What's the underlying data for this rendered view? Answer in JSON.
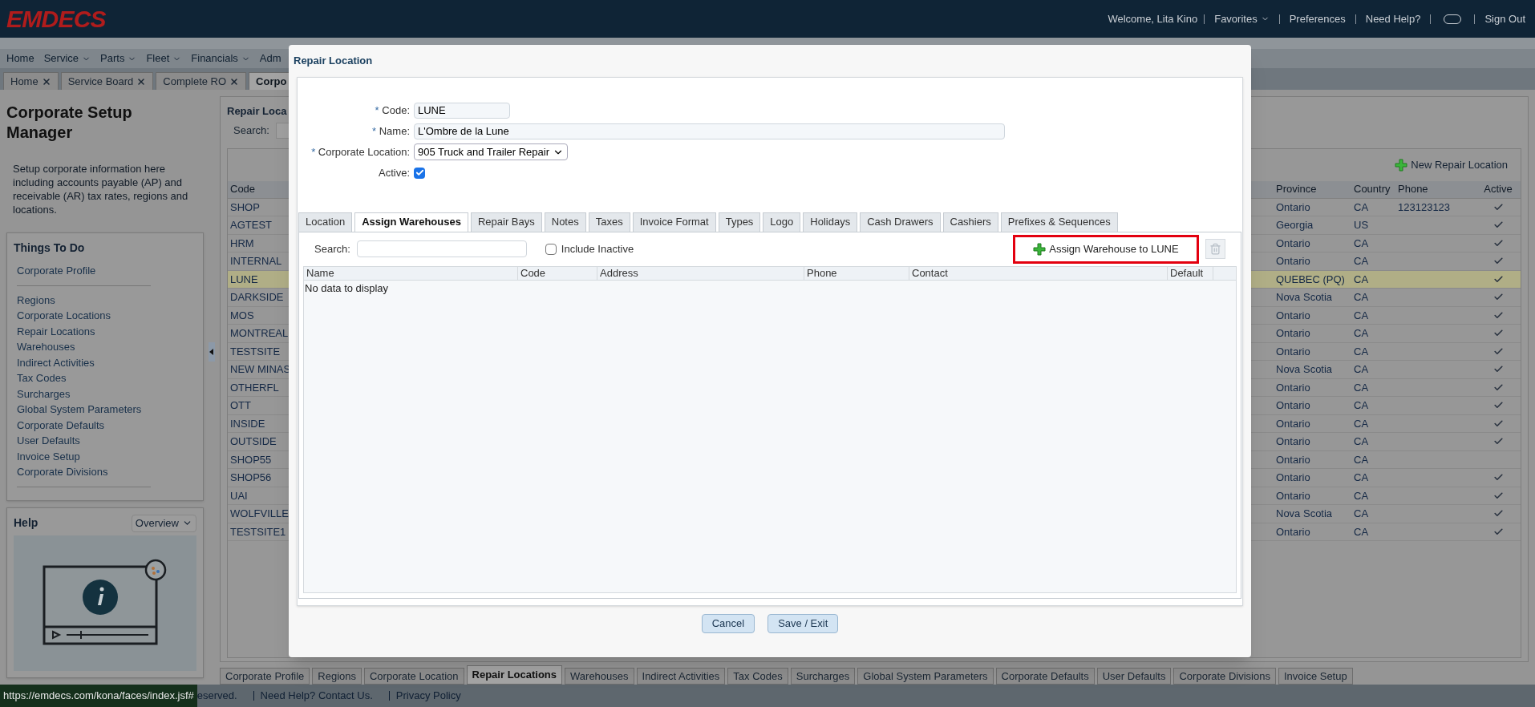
{
  "header": {
    "logo": "EMDECS",
    "welcome": "Welcome, Lita Kino",
    "links": [
      {
        "label": "Favorites",
        "has_menu": true
      },
      {
        "label": "Preferences",
        "has_menu": false
      },
      {
        "label": "Need Help?",
        "has_menu": false
      }
    ],
    "sign_out": "Sign Out"
  },
  "nav": [
    {
      "label": "Home",
      "has_menu": false
    },
    {
      "label": "Service",
      "has_menu": true
    },
    {
      "label": "Parts",
      "has_menu": true
    },
    {
      "label": "Fleet",
      "has_menu": true
    },
    {
      "label": "Financials",
      "has_menu": true
    },
    {
      "label": "Adm",
      "has_menu": false
    }
  ],
  "page_tabs": [
    {
      "label": "Home",
      "selected": false,
      "closable": true
    },
    {
      "label": "Service Board",
      "selected": false,
      "closable": true
    },
    {
      "label": "Complete RO",
      "selected": false,
      "closable": true
    },
    {
      "label": "Corpo",
      "selected": true,
      "closable": false
    }
  ],
  "sidebar": {
    "title": "Corporate Setup Manager",
    "description": "Setup corporate information here including accounts payable (AP) and receivable (AR) tax rates, regions and locations.",
    "things_to_do": {
      "title": "Things To Do",
      "groups": [
        [
          "Corporate Profile"
        ],
        [
          "Regions",
          "Corporate Locations",
          "Repair Locations",
          "Warehouses",
          "Indirect Activities",
          "Tax Codes",
          "Surcharges",
          "Global System Parameters",
          "Corporate Defaults",
          "User Defaults",
          "Invoice Setup",
          "Corporate Divisions"
        ]
      ]
    },
    "help": {
      "title": "Help",
      "dropdown": "Overview"
    }
  },
  "main": {
    "title": "Repair Loca",
    "search_label": "Search:",
    "new_button": "New Repair Location",
    "columns": [
      "Code",
      "Province",
      "Country",
      "Phone",
      "Active"
    ],
    "rows": [
      {
        "code": "SHOP",
        "province": "Ontario",
        "country": "CA",
        "phone": "123123123",
        "active": true,
        "selected": false
      },
      {
        "code": "AGTEST",
        "province": "Georgia",
        "country": "US",
        "active": true,
        "selected": false
      },
      {
        "code": "HRM",
        "province": "Ontario",
        "country": "CA",
        "active": true,
        "selected": false
      },
      {
        "code": "INTERNAL",
        "province": "Ontario",
        "country": "CA",
        "active": true,
        "selected": false
      },
      {
        "code": "LUNE",
        "province": "QUEBEC (PQ)",
        "country": "CA",
        "active": true,
        "selected": true
      },
      {
        "code": "DARKSIDE",
        "province": "Nova Scotia",
        "country": "CA",
        "active": true,
        "selected": false
      },
      {
        "code": "MOS",
        "province": "Ontario",
        "country": "CA",
        "active": true,
        "selected": false
      },
      {
        "code": "MONTREAL",
        "province": "Ontario",
        "country": "CA",
        "active": true,
        "selected": false
      },
      {
        "code": "TESTSITE",
        "province": "Ontario",
        "country": "CA",
        "active": true,
        "selected": false
      },
      {
        "code": "NEW MINAS",
        "province": "Nova Scotia",
        "country": "CA",
        "active": true,
        "selected": false
      },
      {
        "code": "OTHERFL",
        "province": "Ontario",
        "country": "CA",
        "active": true,
        "selected": false
      },
      {
        "code": "OTT",
        "province": "Ontario",
        "country": "CA",
        "active": true,
        "selected": false
      },
      {
        "code": "INSIDE",
        "province": "Ontario",
        "country": "CA",
        "active": true,
        "selected": false
      },
      {
        "code": "OUTSIDE",
        "province": "Ontario",
        "country": "CA",
        "active": true,
        "selected": false
      },
      {
        "code": "SHOP55",
        "province": "Ontario",
        "country": "CA",
        "active": false,
        "selected": false
      },
      {
        "code": "SHOP56",
        "province": "Ontario",
        "country": "CA",
        "active": true,
        "selected": false
      },
      {
        "code": "UAI",
        "province": "Ontario",
        "country": "CA",
        "active": true,
        "selected": false
      },
      {
        "code": "WOLFVILLE",
        "province": "Nova Scotia",
        "country": "CA",
        "active": true,
        "selected": false
      },
      {
        "code": "TESTSITE1",
        "province": "Ontario",
        "country": "CA",
        "active": true,
        "selected": false
      }
    ]
  },
  "bottom_tabs": [
    {
      "label": "Corporate Profile",
      "selected": false
    },
    {
      "label": "Regions",
      "selected": false
    },
    {
      "label": "Corporate Location",
      "selected": false
    },
    {
      "label": "Repair Locations",
      "selected": true
    },
    {
      "label": "Warehouses",
      "selected": false
    },
    {
      "label": "Indirect Activities",
      "selected": false
    },
    {
      "label": "Tax Codes",
      "selected": false
    },
    {
      "label": "Surcharges",
      "selected": false
    },
    {
      "label": "Global System Parameters",
      "selected": false
    },
    {
      "label": "Corporate Defaults",
      "selected": false
    },
    {
      "label": "User Defaults",
      "selected": false
    },
    {
      "label": "Corporate Divisions",
      "selected": false
    },
    {
      "label": "Invoice Setup",
      "selected": false
    }
  ],
  "footer": {
    "status_url": "https://emdecs.com/kona/faces/index.jsf#",
    "text": "eserved.",
    "links": [
      "Need Help? Contact Us.",
      "Privacy Policy"
    ]
  },
  "dialog": {
    "title": "Repair Location",
    "fields": [
      {
        "kind": "text",
        "label": "Code:",
        "marker": "*",
        "value": "LUNE",
        "wide": false
      },
      {
        "kind": "text",
        "label": "Name:",
        "marker": "*",
        "value": "L'Ombre de la Lune",
        "wide": true
      },
      {
        "kind": "select",
        "label": "Corporate Location:",
        "marker": "*",
        "value": "905 Truck and Trailer Repair"
      },
      {
        "kind": "checkbox",
        "label": "Active:",
        "checked": true
      }
    ],
    "tabs": [
      {
        "label": "Location",
        "selected": false
      },
      {
        "label": "Assign Warehouses",
        "selected": true
      },
      {
        "label": "Repair Bays",
        "selected": false
      },
      {
        "label": "Notes",
        "selected": false
      },
      {
        "label": "Taxes",
        "selected": false
      },
      {
        "label": "Invoice Format",
        "selected": false
      },
      {
        "label": "Types",
        "selected": false
      },
      {
        "label": "Logo",
        "selected": false
      },
      {
        "label": "Holidays",
        "selected": false
      },
      {
        "label": "Cash Drawers",
        "selected": false
      },
      {
        "label": "Cashiers",
        "selected": false
      },
      {
        "label": "Prefixes & Sequences",
        "selected": false
      }
    ],
    "search_label": "Search:",
    "include_inactive": {
      "label": "Include Inactive",
      "checked": false
    },
    "assign_button": {
      "label": "Assign Warehouse to LUNE",
      "highlighted": true
    },
    "delete_disabled": true,
    "columns": [
      "Name",
      "Code",
      "Address",
      "Phone",
      "Contact",
      "Default"
    ],
    "empty": "No data to display",
    "buttons": [
      "Cancel",
      "Save / Exit"
    ]
  }
}
